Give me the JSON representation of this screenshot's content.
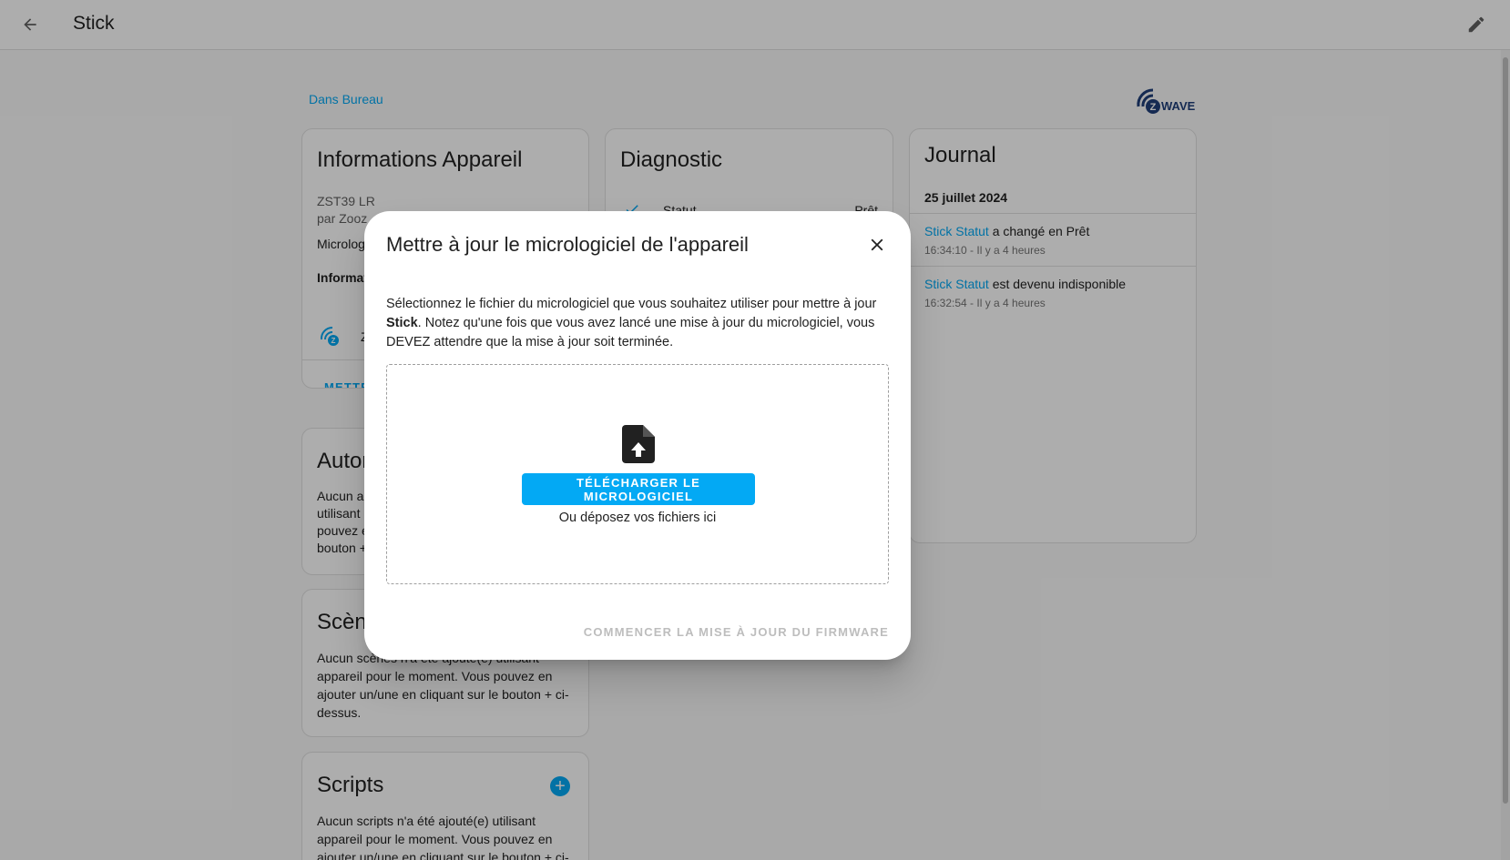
{
  "topbar": {
    "title": "Stick"
  },
  "area_link": "Dans Bureau",
  "device_info": {
    "title": "Informations Appareil",
    "model": "ZST39 LR",
    "manufacturer": "par Zooz",
    "firmware_partial": "Microlog",
    "section_partial": "Informat",
    "zwave_partial": "Z",
    "action_partial": "METTR"
  },
  "diagnostic": {
    "title": "Diagnostic",
    "status_label": "Statut",
    "status_value": "Prêt"
  },
  "journal": {
    "title": "Journal",
    "date": "25 juillet 2024",
    "entries": [
      {
        "entity": "Stick Statut",
        "text": " a changé en Prêt",
        "time": "16:34:10 - Il y a 4 heures"
      },
      {
        "entity": "Stick Statut",
        "text": " est devenu indisponible",
        "time": "16:32:54 - Il y a 4 heures"
      }
    ]
  },
  "automations": {
    "title_partial": "Autom",
    "lines": [
      "Aucun a",
      "utilisant",
      "pouvez e",
      "bouton +"
    ]
  },
  "scenes": {
    "title_partial": "Scèn",
    "lines": [
      "Aucun scènes n'a été ajouté(e) utilisant",
      "appareil pour le moment. Vous pouvez en",
      "ajouter un/une en cliquant sur le bouton + ci-",
      "dessus."
    ]
  },
  "scripts": {
    "title": "Scripts",
    "lines": [
      "Aucun scripts n'a été ajouté(e) utilisant",
      "appareil pour le moment. Vous pouvez en",
      "ajouter un/une en cliquant sur le bouton + ci-"
    ]
  },
  "dialog": {
    "title": "Mettre à jour le micrologiciel de l'appareil",
    "text_before": "Sélectionnez le fichier du micrologiciel que vous souhaitez utiliser pour mettre à jour ",
    "text_device": "Stick",
    "text_after": ". Notez qu'une fois que vous avez lancé une mise à jour du micrologiciel, vous DEVEZ attendre que la mise à jour soit terminée.",
    "upload_button": "TÉLÉCHARGER LE MICROLOGICIEL",
    "drop_hint": "Ou déposez vos fichiers ici",
    "start_button": "COMMENCER LA MISE À JOUR DU FIRMWARE"
  },
  "colors": {
    "accent": "#03a9f4",
    "overlay": "rgba(0,0,0,0.32)",
    "disabled": "#bdbdbd"
  },
  "icons": [
    "back-arrow-icon",
    "pencil-icon",
    "zwave-logo",
    "zwave-icon",
    "close-icon",
    "file-upload-icon",
    "plus-circle-icon",
    "check-icon"
  ]
}
